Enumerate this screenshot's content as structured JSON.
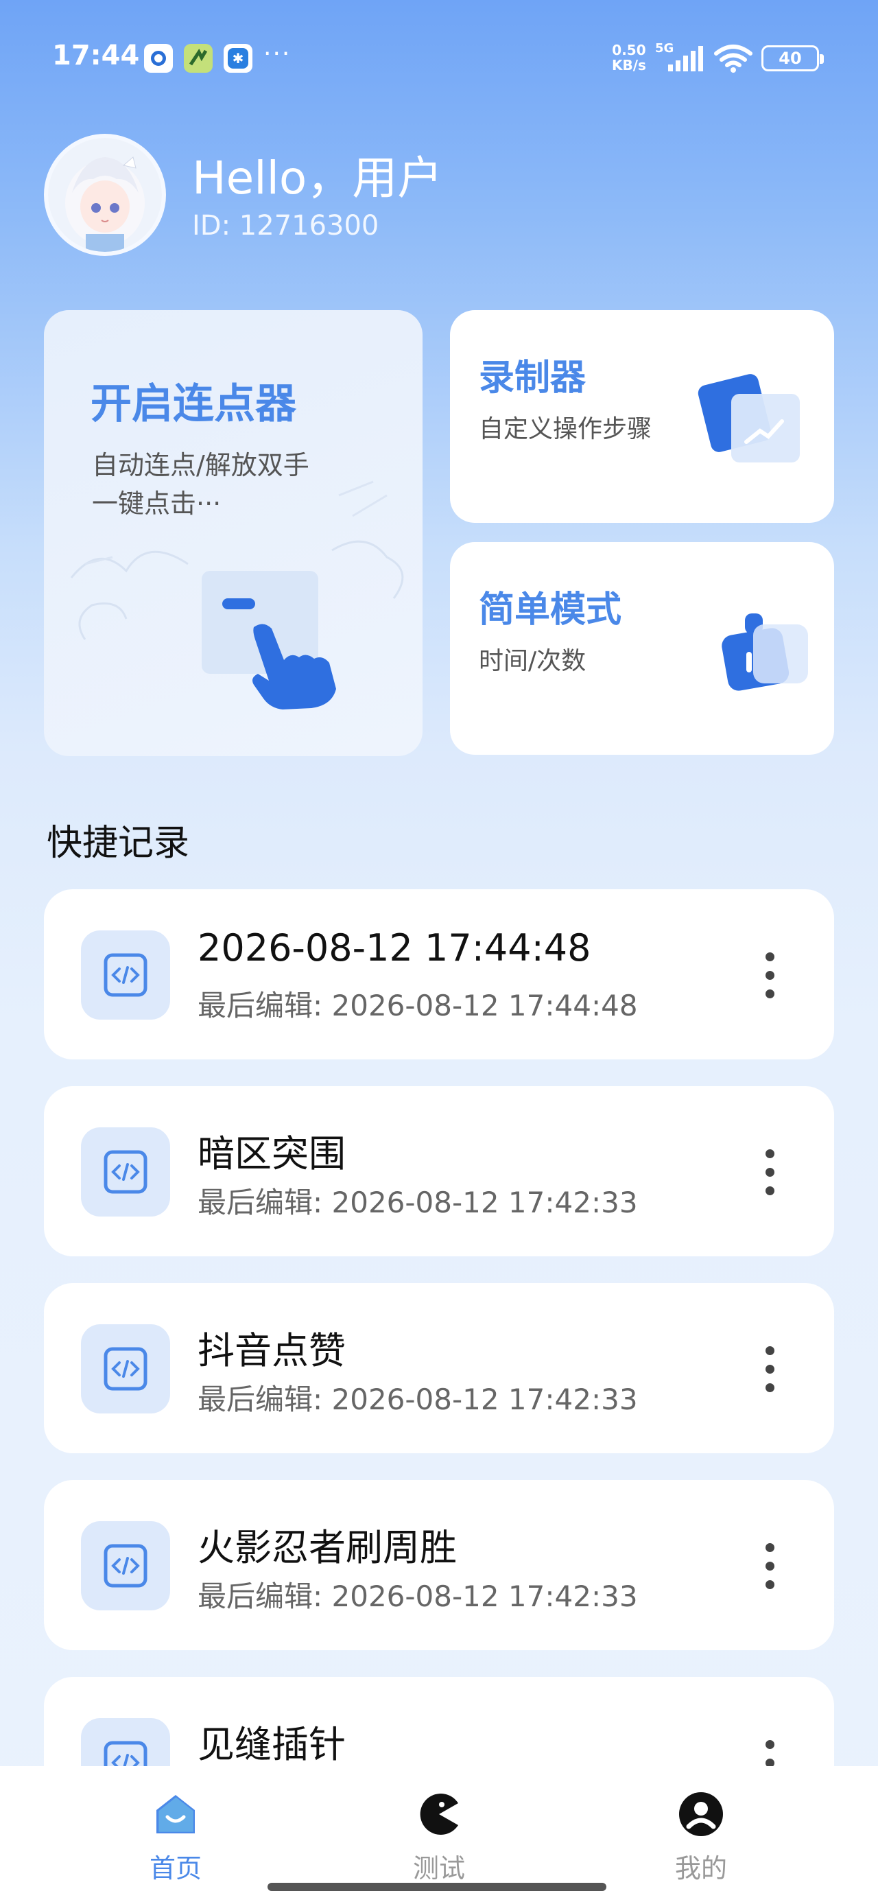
{
  "status_bar": {
    "time": "17:44",
    "dots": "···",
    "net_speed_value": "0.50",
    "net_speed_unit": "KB/s",
    "network": "5G",
    "battery": "40",
    "icons": [
      "app-icon-blue",
      "app-icon-green",
      "app-icon-blue-2",
      "signal-icon",
      "wifi-icon",
      "battery-icon"
    ]
  },
  "header": {
    "greeting": "Hello，用户",
    "user_id": "ID: 12716300"
  },
  "cards": {
    "start": {
      "title": "开启连点器",
      "subtitle_line1": "自动连点/解放双手",
      "subtitle_line2": "一键点击···"
    },
    "recorder": {
      "title": "录制器",
      "subtitle": "自定义操作步骤"
    },
    "simple": {
      "title": "简单模式",
      "subtitle": "时间/次数"
    }
  },
  "section_title": "快捷记录",
  "records": [
    {
      "title": "2026-08-12 17:44:48",
      "subtitle": "最后编辑: 2026-08-12 17:44:48"
    },
    {
      "title": "暗区突围",
      "subtitle": "最后编辑: 2026-08-12 17:42:33"
    },
    {
      "title": "抖音点赞",
      "subtitle": "最后编辑: 2026-08-12 17:42:33"
    },
    {
      "title": "火影忍者刷周胜",
      "subtitle": "最后编辑: 2026-08-12 17:42:33"
    },
    {
      "title": "见缝插针",
      "subtitle": ""
    }
  ],
  "nav": {
    "home": "首页",
    "test": "测试",
    "mine": "我的"
  },
  "colors": {
    "accent": "#4a88e8",
    "icon_bg": "#dde9fb"
  }
}
